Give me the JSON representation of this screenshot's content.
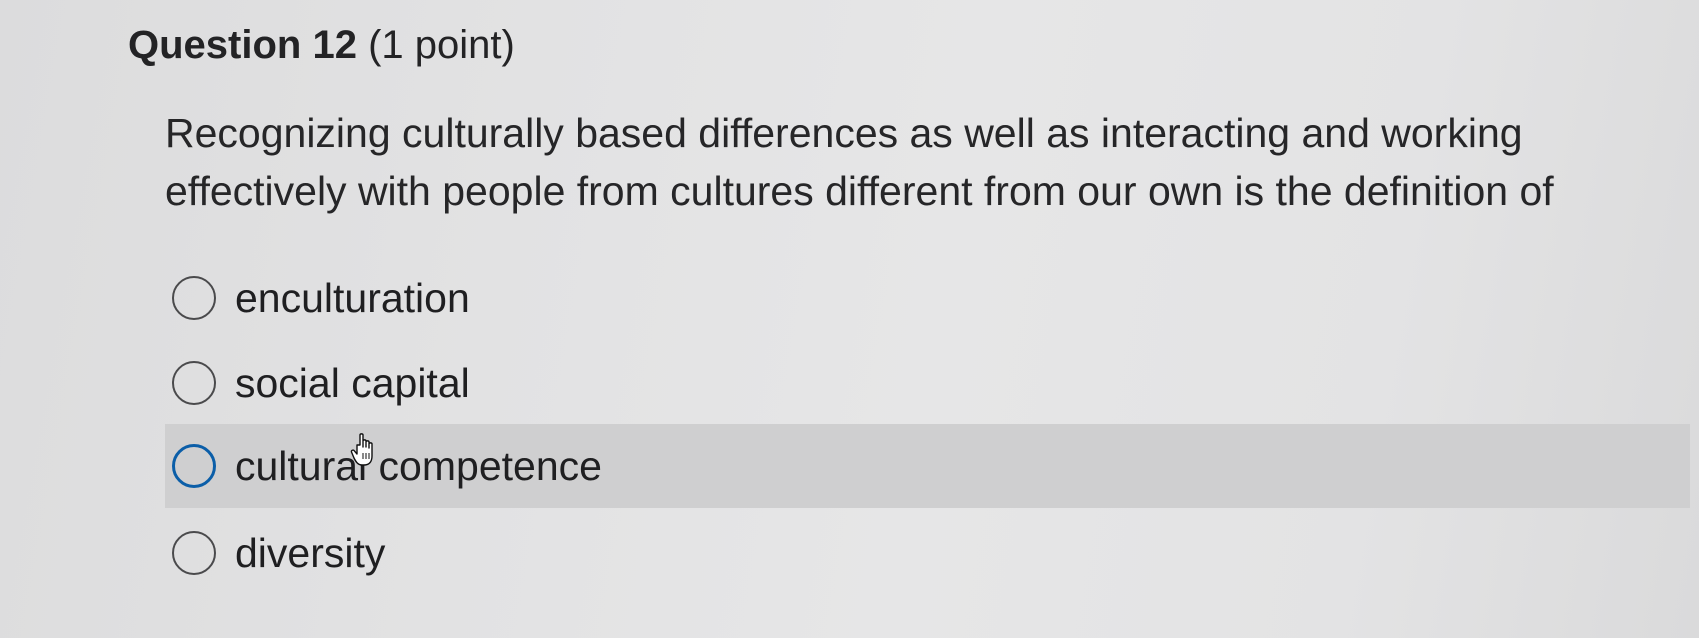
{
  "question": {
    "number": "Question 12",
    "points": "(1 point)",
    "text": "Recognizing culturally based differences as well as interacting and working effectively with people from cultures different from our own is the definition of"
  },
  "options": [
    {
      "label": "enculturation",
      "selected": false
    },
    {
      "label": "social capital",
      "selected": false
    },
    {
      "label": "cultural competence",
      "selected": false,
      "hovered": true
    },
    {
      "label": "diversity",
      "selected": false
    }
  ],
  "colors": {
    "hover_background": "#cfcfd0",
    "focus_ring": "#0b5ea8",
    "text": "#2a2a2c"
  },
  "cursor": "hand-pointer-icon"
}
